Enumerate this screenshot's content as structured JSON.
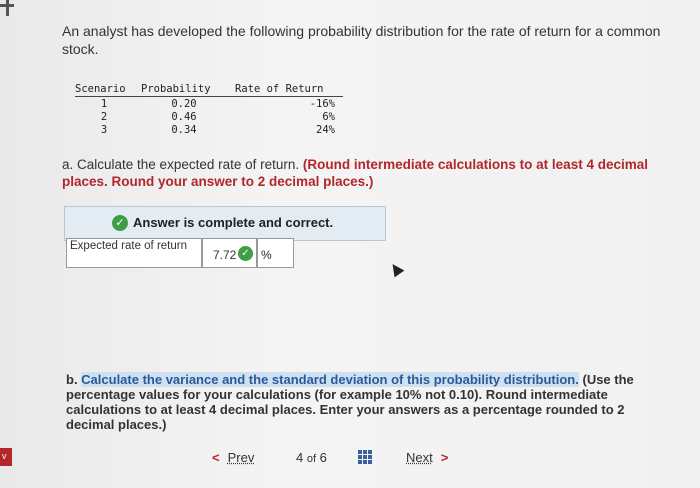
{
  "question": {
    "text": "An analyst has developed the following probability distribution for the rate of return for a common stock."
  },
  "distribution": {
    "headers": [
      "Scenario",
      "Probability",
      "Rate of Return"
    ],
    "rows": [
      [
        "1",
        "0.20",
        "-16%"
      ],
      [
        "2",
        "0.46",
        "6%"
      ],
      [
        "3",
        "0.34",
        "24%"
      ]
    ]
  },
  "part_a": {
    "prefix": "a. Calculate the expected rate of return. ",
    "instruction": "(Round intermediate calculations to at least 4 decimal places. Round your answer to 2 decimal places.)"
  },
  "answer_status": "Answer is complete and correct.",
  "result": {
    "label": "Expected rate of return",
    "value": "7.72",
    "unit": "%"
  },
  "part_b": {
    "prefix": "b. ",
    "highlighted": "Calculate the variance and the standard deviation of this probability distribution.",
    "instruction": " (Use the percentage values for your calculations (for example 10% not 0.10). Round intermediate calculations to at least 4 decimal places. Enter your answers as a percentage rounded to 2 decimal places.)"
  },
  "navigation": {
    "prev_label": "Prev",
    "current_page": "4",
    "of_label": "of",
    "total_pages": "6",
    "next_label": "Next"
  },
  "colors": {
    "accent_red": "#b3262a",
    "correct_green": "#3e9d47",
    "highlight_blue": "#cfe0f2"
  }
}
